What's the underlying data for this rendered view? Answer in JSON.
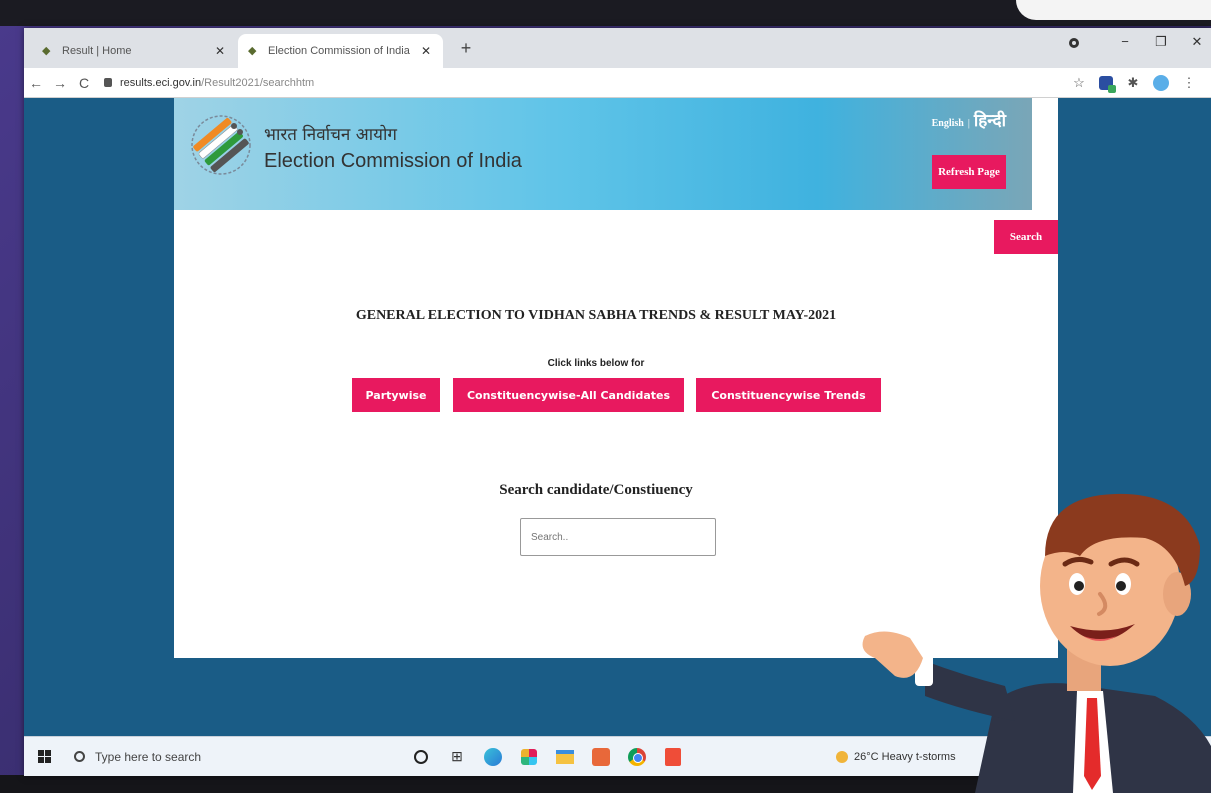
{
  "browser": {
    "tabs": [
      {
        "title": "Result | Home",
        "active": false
      },
      {
        "title": "Election Commission of India",
        "active": true
      }
    ],
    "new_tab_symbol": "+",
    "window_controls": {
      "minimize": "−",
      "restore": "❐",
      "close": "✕"
    },
    "url_host": "results.eci.gov.in",
    "url_path": "/Result2021/searchhtm",
    "nav": {
      "back": "←",
      "forward": "→",
      "reload": "C"
    },
    "toolbar_icons": [
      "star-icon",
      "extensions-icon",
      "puzzle-icon",
      "profile-avatar",
      "menu-icon"
    ]
  },
  "page": {
    "hindi_title": "भारत निर्वाचन आयोग",
    "english_title": "Election Commission of India",
    "lang_english": "English",
    "lang_separator": "|",
    "lang_hindi": "हिन्दी",
    "refresh_label": "Refresh Page",
    "search_label": "Search",
    "heading": "GENERAL ELECTION TO VIDHAN SABHA TRENDS & RESULT MAY-2021",
    "click_note": "Click links below for",
    "links": {
      "partywise": "Partywise",
      "constituency_all": "Constituencywise-All Candidates",
      "constituency_trends": "Constituencywise Trends"
    },
    "search_heading": "Search candidate/Constiuency",
    "search_placeholder": "Search.."
  },
  "taskbar": {
    "search_placeholder": "Type here to search",
    "weather": "26°C  Heavy t-storms",
    "tray": "^"
  },
  "colors": {
    "accent_pink": "#e8195f",
    "page_bg": "#1a5c86",
    "backdrop": "#3b2f72"
  }
}
